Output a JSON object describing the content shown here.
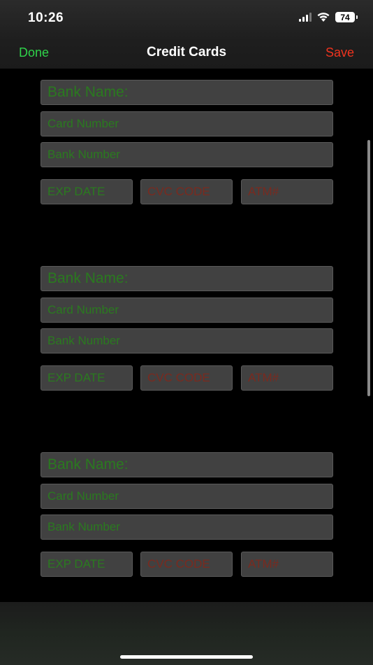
{
  "status_bar": {
    "time": "10:26",
    "battery": "74"
  },
  "nav": {
    "done_label": "Done",
    "title": "Credit Cards",
    "save_label": "Save"
  },
  "cards": [
    {
      "bank_name_placeholder": "Bank Name:",
      "card_number_placeholder": "Card Number",
      "bank_number_placeholder": "Bank Number",
      "exp_date_placeholder": "EXP DATE",
      "cvc_code_placeholder": "CVC CODE",
      "atm_placeholder": "ATM#"
    },
    {
      "bank_name_placeholder": "Bank Name:",
      "card_number_placeholder": "Card Number",
      "bank_number_placeholder": "Bank Number",
      "exp_date_placeholder": "EXP DATE",
      "cvc_code_placeholder": "CVC CODE",
      "atm_placeholder": "ATM#"
    },
    {
      "bank_name_placeholder": "Bank Name:",
      "card_number_placeholder": "Card Number",
      "bank_number_placeholder": "Bank Number",
      "exp_date_placeholder": "EXP DATE",
      "cvc_code_placeholder": "CVC CODE",
      "atm_placeholder": "ATM#"
    }
  ],
  "colors": {
    "done": "#2fd24a",
    "save": "#f0331e",
    "field_background": "#414141",
    "green_placeholder": "#2a7a1f",
    "red_placeholder": "#7a2a1f"
  },
  "icons": [
    "cellular-signal-icon",
    "wifi-icon",
    "battery-icon"
  ]
}
